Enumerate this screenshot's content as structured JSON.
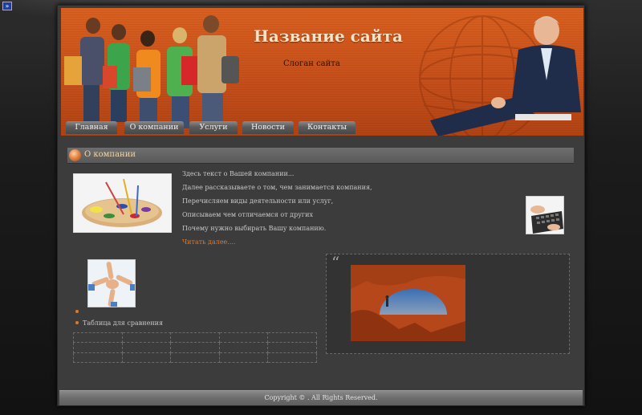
{
  "corner_toggle": {
    "label": "»",
    "icon": "double-chevron-right-icon"
  },
  "header": {
    "site_title": "Название сайта",
    "slogan": "Слоган сайта",
    "background_color": "#c7501b"
  },
  "nav": {
    "items": [
      {
        "label": "Главная"
      },
      {
        "label": "О компании"
      },
      {
        "label": "Услуги"
      },
      {
        "label": "Новости"
      },
      {
        "label": "Контакты"
      }
    ]
  },
  "about": {
    "section_title": "О компании",
    "lines": [
      "Здесь текст о Вашей компании...",
      "Далее рассказываете о том, чем занимается компания,",
      "Перечисляем виды деятельности или услуг,",
      "Описываем чем отличаемся от других",
      "Почему нужно выбирать Вашу компанию."
    ],
    "read_more": "Читать далее...."
  },
  "lower": {
    "bullets": [
      "",
      "Таблица для сравнения"
    ],
    "table_rows": 3,
    "table_cols": 5,
    "quote_icon": "quote-icon",
    "quote_glyph": "“"
  },
  "footer": {
    "copyright": "Copyright © .    All Rights Reserved."
  },
  "colors": {
    "accent": "#e0782a",
    "header_orange": "#c7501b",
    "page_bg": "#141414",
    "panel_bg": "#3c3c3c"
  }
}
